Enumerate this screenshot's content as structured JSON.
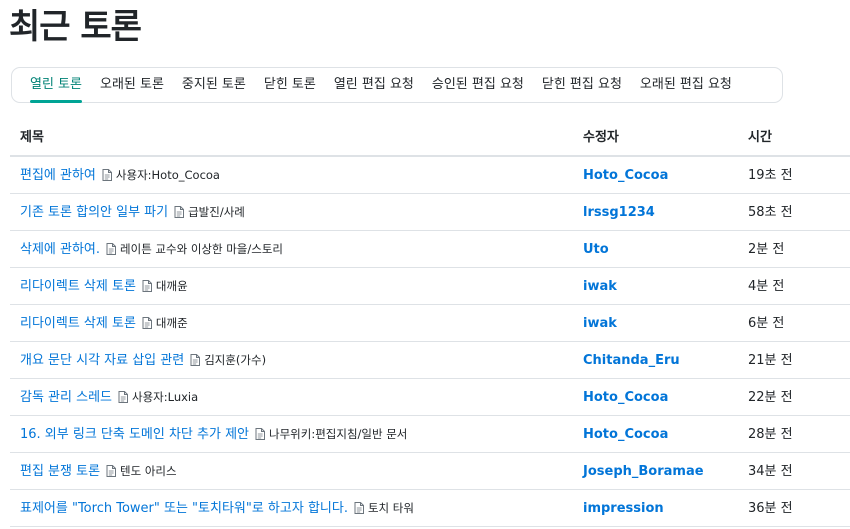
{
  "page_title": "최근 토론",
  "tabs": [
    {
      "label": "열린 토론",
      "active": true
    },
    {
      "label": "오래된 토론",
      "active": false
    },
    {
      "label": "중지된 토론",
      "active": false
    },
    {
      "label": "닫힌 토론",
      "active": false
    },
    {
      "label": "열린 편집 요청",
      "active": false
    },
    {
      "label": "승인된 편집 요청",
      "active": false
    },
    {
      "label": "닫힌 편집 요청",
      "active": false
    },
    {
      "label": "오래된 편집 요청",
      "active": false
    }
  ],
  "table": {
    "headers": {
      "title": "제목",
      "editor": "수정자",
      "time": "시간"
    },
    "rows": [
      {
        "topic": "편집에 관하여",
        "document": "사용자:Hoto_Cocoa",
        "editor": "Hoto_Cocoa",
        "time": "19초 전"
      },
      {
        "topic": "기존 토론 합의안 일부 파기",
        "document": "급발진/사례",
        "editor": "lrssg1234",
        "time": "58초 전"
      },
      {
        "topic": "삭제에 관하여.",
        "document": "레이튼 교수와 이상한 마을/스토리",
        "editor": "Uto",
        "time": "2분 전"
      },
      {
        "topic": "리다이렉트 삭제 토론",
        "document": "대깨윤",
        "editor": "iwak",
        "time": "4분 전"
      },
      {
        "topic": "리다이렉트 삭제 토론",
        "document": "대깨준",
        "editor": "iwak",
        "time": "6분 전"
      },
      {
        "topic": "개요 문단 시각 자료 삽입 관련",
        "document": "김지훈(가수)",
        "editor": "Chitanda_Eru",
        "time": "21분 전"
      },
      {
        "topic": "감독 관리 스레드",
        "document": "사용자:Luxia",
        "editor": "Hoto_Cocoa",
        "time": "22분 전"
      },
      {
        "topic": "16. 외부 링크 단축 도메인 차단 추가 제안",
        "document": "나무위키:편집지침/일반 문서",
        "editor": "Hoto_Cocoa",
        "time": "28분 전"
      },
      {
        "topic": "편집 분쟁 토론",
        "document": "텐도 아리스",
        "editor": "Joseph_Boramae",
        "time": "34분 전"
      },
      {
        "topic": "표제어를 \"Torch Tower\" 또는 \"토치타워\"로 하고자 합니다.",
        "document": "토치 타워",
        "editor": "impression",
        "time": "36분 전"
      }
    ]
  },
  "icons": {
    "document": "document-icon"
  },
  "colors": {
    "link": "#0275d8",
    "active_tab": "#008275",
    "active_tab_underline": "#00a495",
    "border": "#dee2e6"
  }
}
